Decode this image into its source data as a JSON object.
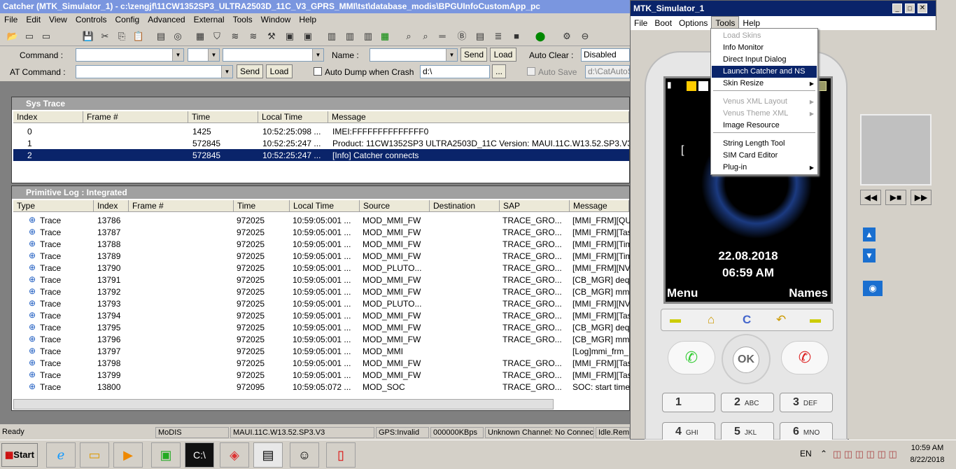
{
  "catcher": {
    "title": "Catcher (MTK_Simulator_1) - c:\\zengjf\\11CW1352SP3_ULTRA2503D_11C_V3_GPRS_MMI\\tst\\database_modis\\BPGUInfoCustomApp_pc",
    "menu": [
      "File",
      "Edit",
      "View",
      "Controls",
      "Config",
      "Advanced",
      "External",
      "Tools",
      "Window",
      "Help"
    ],
    "command_label": "Command :",
    "name_label": "Name :",
    "send": "Send",
    "load": "Load",
    "auto_clear_label": "Auto Clear :",
    "auto_clear_value": "Disabled",
    "at_command_label": "AT Command :",
    "auto_dump_label": "Auto Dump when Crash",
    "auto_dump_path": "d:\\",
    "browse": "...",
    "auto_save_label": "Auto Save",
    "auto_save_path": "d:\\CatAutoS"
  },
  "sys_trace": {
    "title": "Sys Trace",
    "columns": [
      "Index",
      "Frame #",
      "Time",
      "Local Time",
      "Message"
    ],
    "rows": [
      {
        "index": "0",
        "frame": "",
        "time": "1425",
        "local": "10:52:25:098 ...",
        "msg": "IMEI:FFFFFFFFFFFFFF0"
      },
      {
        "index": "1",
        "frame": "",
        "time": "572845",
        "local": "10:52:25:247 ...",
        "msg": "Product: 11CW1352SP3 ULTRA2503D_11C Version: MAUI.11C.W13.52.SP3.V3"
      },
      {
        "index": "2",
        "frame": "",
        "time": "572845",
        "local": "10:52:25:247 ...",
        "msg": "[Info] Catcher connects"
      }
    ],
    "selected_row": 2
  },
  "prim_log": {
    "title": "Primitive Log : Integrated",
    "columns": [
      "Type",
      "Index",
      "Frame #",
      "Time",
      "Local Time",
      "Source",
      "Destination",
      "SAP",
      "Message"
    ],
    "rows": [
      {
        "type": "Trace",
        "index": "13786",
        "time": "972025",
        "local": "10:59:05:001 ...",
        "src": "MOD_MMI_FW",
        "dst": "",
        "sap": "TRACE_GRO...",
        "msg": "[MMI_FRM][QU"
      },
      {
        "type": "Trace",
        "index": "13787",
        "time": "972025",
        "local": "10:59:05:001 ...",
        "src": "MOD_MMI_FW",
        "dst": "",
        "sap": "TRACE_GRO...",
        "msg": "[MMI_FRM][Tas"
      },
      {
        "type": "Trace",
        "index": "13788",
        "time": "972025",
        "local": "10:59:05:001 ...",
        "src": "MOD_MMI_FW",
        "dst": "",
        "sap": "TRACE_GRO...",
        "msg": "[MMI_FRM][Tim"
      },
      {
        "type": "Trace",
        "index": "13789",
        "time": "972025",
        "local": "10:59:05:001 ...",
        "src": "MOD_MMI_FW",
        "dst": "",
        "sap": "TRACE_GRO...",
        "msg": "[MMI_FRM][Tim"
      },
      {
        "type": "Trace",
        "index": "13790",
        "time": "972025",
        "local": "10:59:05:001 ...",
        "src": "MOD_PLUTO...",
        "dst": "",
        "sap": "TRACE_GRO...",
        "msg": "[MMI_FRM][NVF"
      },
      {
        "type": "Trace",
        "index": "13791",
        "time": "972025",
        "local": "10:59:05:001 ...",
        "src": "MOD_MMI_FW",
        "dst": "",
        "sap": "TRACE_GRO...",
        "msg": "[CB_MGR] deq"
      },
      {
        "type": "Trace",
        "index": "13792",
        "time": "972025",
        "local": "10:59:05:001 ...",
        "src": "MOD_MMI_FW",
        "dst": "",
        "sap": "TRACE_GRO...",
        "msg": "[CB_MGR] mm"
      },
      {
        "type": "Trace",
        "index": "13793",
        "time": "972025",
        "local": "10:59:05:001 ...",
        "src": "MOD_PLUTO...",
        "dst": "",
        "sap": "TRACE_GRO...",
        "msg": "[MMI_FRM][NVF"
      },
      {
        "type": "Trace",
        "index": "13794",
        "time": "972025",
        "local": "10:59:05:001 ...",
        "src": "MOD_MMI_FW",
        "dst": "",
        "sap": "TRACE_GRO...",
        "msg": "[MMI_FRM][Tas"
      },
      {
        "type": "Trace",
        "index": "13795",
        "time": "972025",
        "local": "10:59:05:001 ...",
        "src": "MOD_MMI_FW",
        "dst": "",
        "sap": "TRACE_GRO...",
        "msg": "[CB_MGR] deq"
      },
      {
        "type": "Trace",
        "index": "13796",
        "time": "972025",
        "local": "10:59:05:001 ...",
        "src": "MOD_MMI_FW",
        "dst": "",
        "sap": "TRACE_GRO...",
        "msg": "[CB_MGR] mm"
      },
      {
        "type": "Trace",
        "index": "13797",
        "time": "972025",
        "local": "10:59:05:001 ...",
        "src": "MOD_MMI",
        "dst": "",
        "sap": "",
        "msg": "[Log]mmi_frm_"
      },
      {
        "type": "Trace",
        "index": "13798",
        "time": "972025",
        "local": "10:59:05:001 ...",
        "src": "MOD_MMI_FW",
        "dst": "",
        "sap": "TRACE_GRO...",
        "msg": "[MMI_FRM][Tas"
      },
      {
        "type": "Trace",
        "index": "13799",
        "time": "972025",
        "local": "10:59:05:001 ...",
        "src": "MOD_MMI_FW",
        "dst": "",
        "sap": "TRACE_GRO...",
        "msg": "[MMI_FRM][Tas"
      },
      {
        "type": "Trace",
        "index": "13800",
        "time": "972095",
        "local": "10:59:05:072 ...",
        "src": "MOD_SOC",
        "dst": "",
        "sap": "TRACE_GRO...",
        "msg": "SOC: start time"
      }
    ]
  },
  "status": [
    "Ready",
    "MoDIS",
    "MAUI.11C.W13.52.SP3.V3",
    "GPS:Invalid",
    "000000KBps",
    "Unknown Channel: No Connection",
    "Idle.Rema"
  ],
  "simulator": {
    "title": "MTK_Simulator_1",
    "menu": [
      "File",
      "Boot",
      "Options",
      "Tools",
      "Help"
    ],
    "tools_menu": [
      {
        "label": "Load Skins",
        "disabled": true
      },
      {
        "label": "Info Monitor"
      },
      {
        "label": "Direct Input Dialog"
      },
      {
        "label": "Launch Catcher and NS",
        "selected": true
      },
      {
        "label": "Skin Resize",
        "submenu": true
      },
      {
        "label": "Venus XML Layout",
        "disabled": true,
        "submenu": true
      },
      {
        "label": "Venus Theme XML",
        "disabled": true,
        "submenu": true
      },
      {
        "label": "Image Resource"
      },
      {
        "label": "String Length Tool"
      },
      {
        "label": "SIM Card Editor"
      },
      {
        "label": "Plug-in",
        "submenu": true
      }
    ],
    "screen": {
      "date": "22.08.2018",
      "time": "06:59 AM",
      "left_soft": "Menu",
      "right_soft": "Names"
    },
    "ok": "OK",
    "keys": [
      [
        "1",
        ""
      ],
      [
        "2",
        "ABC"
      ],
      [
        "3",
        "DEF"
      ],
      [
        "4",
        "GHI"
      ],
      [
        "5",
        "JKL"
      ],
      [
        "6",
        "MNO"
      ]
    ]
  },
  "taskbar": {
    "start": "Start",
    "lang": "EN",
    "time": "10:59 AM",
    "date": "8/22/2018"
  }
}
